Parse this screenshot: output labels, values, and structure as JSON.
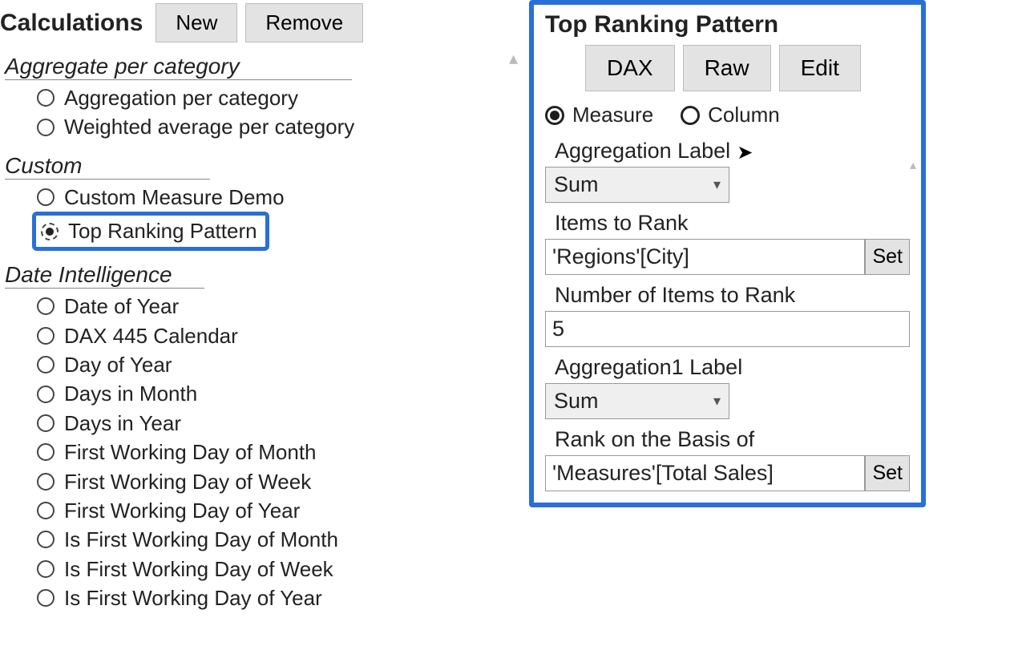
{
  "left": {
    "title": "Calculations",
    "new_btn": "New",
    "remove_btn": "Remove",
    "groups": [
      {
        "label": "Aggregate per category",
        "items": [
          {
            "label": "Aggregation per category",
            "selected": false
          },
          {
            "label": "Weighted average per category",
            "selected": false
          }
        ]
      },
      {
        "label": "Custom",
        "items": [
          {
            "label": "Custom Measure Demo",
            "selected": false
          },
          {
            "label": "Top Ranking Pattern",
            "selected": true,
            "highlight": true
          }
        ]
      },
      {
        "label": "Date Intelligence",
        "items": [
          {
            "label": "Date of Year"
          },
          {
            "label": "DAX 445 Calendar"
          },
          {
            "label": "Day of Year"
          },
          {
            "label": "Days in Month"
          },
          {
            "label": "Days in Year"
          },
          {
            "label": "First Working Day of Month"
          },
          {
            "label": "First Working Day of Week"
          },
          {
            "label": "First Working Day of Year"
          },
          {
            "label": "Is First Working Day of Month"
          },
          {
            "label": "Is First Working Day of Week"
          },
          {
            "label": "Is First Working Day of Year"
          }
        ]
      }
    ]
  },
  "right": {
    "title": "Top Ranking Pattern",
    "buttons": {
      "dax": "DAX",
      "raw": "Raw",
      "edit": "Edit"
    },
    "type_radio": {
      "measure": "Measure",
      "column": "Column",
      "selected": "measure"
    },
    "agg_label": "Aggregation Label",
    "agg_value": "Sum",
    "items_label": "Items to Rank",
    "items_value": "'Regions'[City]",
    "set_btn": "Set",
    "num_label": "Number of Items to Rank",
    "num_value": "5",
    "agg1_label": "Aggregation1 Label",
    "agg1_value": "Sum",
    "basis_label": "Rank on the Basis of",
    "basis_value": "'Measures'[Total Sales]"
  }
}
